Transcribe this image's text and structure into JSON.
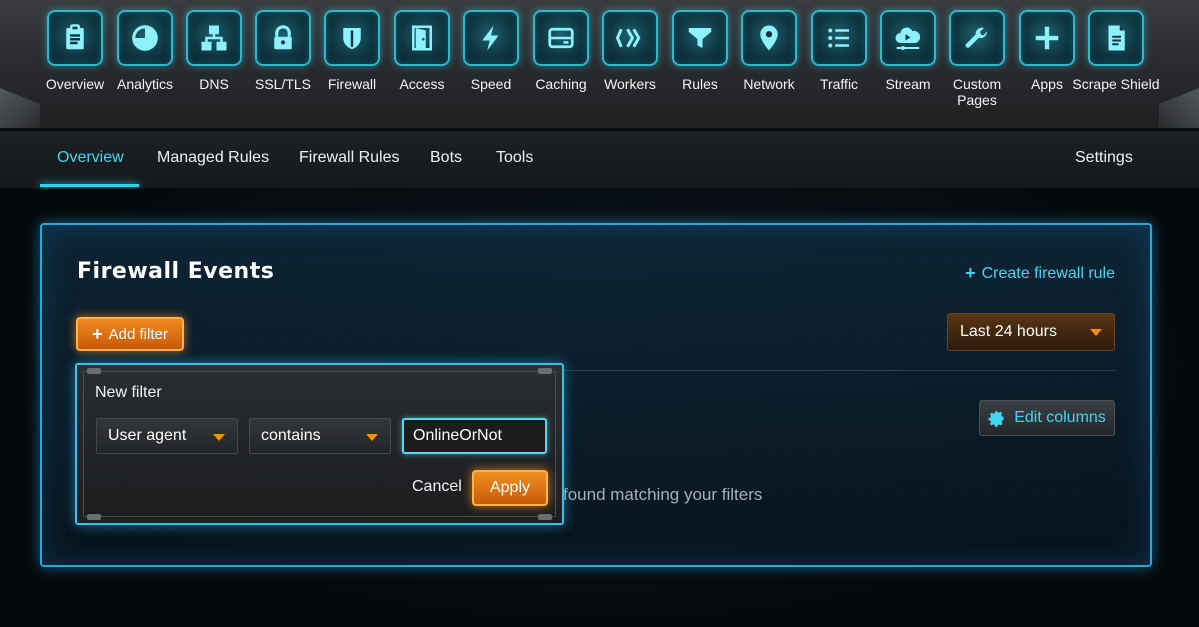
{
  "topnav": {
    "items": [
      {
        "label": "Overview",
        "icon": "clipboard-icon"
      },
      {
        "label": "Analytics",
        "icon": "pie-chart-icon"
      },
      {
        "label": "DNS",
        "icon": "network-tree-icon"
      },
      {
        "label": "SSL/TLS",
        "icon": "lock-icon"
      },
      {
        "label": "Firewall",
        "icon": "shield-icon"
      },
      {
        "label": "Access",
        "icon": "door-icon"
      },
      {
        "label": "Speed",
        "icon": "lightning-icon"
      },
      {
        "label": "Caching",
        "icon": "server-icon"
      },
      {
        "label": "Workers",
        "icon": "workers-icon"
      },
      {
        "label": "Rules",
        "icon": "funnel-icon"
      },
      {
        "label": "Network",
        "icon": "location-pin-icon"
      },
      {
        "label": "Traffic",
        "icon": "list-icon"
      },
      {
        "label": "Stream",
        "icon": "cloud-stream-icon"
      },
      {
        "label": "Custom Pages",
        "icon": "wrench-icon"
      },
      {
        "label": "Apps",
        "icon": "plus-icon"
      },
      {
        "label": "Scrape Shield",
        "icon": "document-icon"
      }
    ]
  },
  "subnav": {
    "tabs": [
      {
        "label": "Overview",
        "active": true
      },
      {
        "label": "Managed Rules",
        "active": false
      },
      {
        "label": "Firewall Rules",
        "active": false
      },
      {
        "label": "Bots",
        "active": false
      },
      {
        "label": "Tools",
        "active": false
      }
    ],
    "settings_label": "Settings"
  },
  "panel": {
    "title": "Firewall Events",
    "create_rule_label": "Create firewall rule",
    "add_filter_label": "Add filter",
    "time_range": "Last 24 hours",
    "edit_columns_label": "Edit columns",
    "empty_text": "found matching your filters"
  },
  "filter_popover": {
    "title": "New filter",
    "field": "User agent",
    "operator": "contains",
    "value": "OnlineOrNot",
    "cancel_label": "Cancel",
    "apply_label": "Apply"
  },
  "colors": {
    "accent_cyan": "#3fd6f0",
    "accent_orange": "#f08a1e",
    "panel_border": "#2aa9d8"
  }
}
